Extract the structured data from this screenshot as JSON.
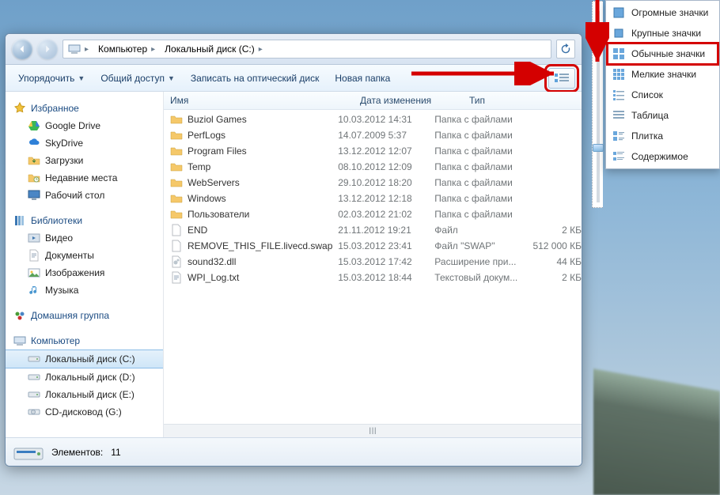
{
  "breadcrumb": {
    "root": "Компьютер",
    "drive": "Локальный диск (C:)"
  },
  "toolbar": {
    "organize": "Упорядочить",
    "share": "Общий доступ",
    "burn": "Записать на оптический диск",
    "newfolder": "Новая папка"
  },
  "columns": {
    "name": "Имя",
    "date": "Дата изменения",
    "type": "Тип"
  },
  "sidebar": {
    "favorites": {
      "label": "Избранное",
      "items": [
        "Google Drive",
        "SkyDrive",
        "Загрузки",
        "Недавние места",
        "Рабочий стол"
      ]
    },
    "libraries": {
      "label": "Библиотеки",
      "items": [
        "Видео",
        "Документы",
        "Изображения",
        "Музыка"
      ]
    },
    "homegroup": {
      "label": "Домашняя группа"
    },
    "computer": {
      "label": "Компьютер",
      "items": [
        "Локальный диск (C:)",
        "Локальный диск (D:)",
        "Локальный диск (E:)",
        "CD-дисковод (G:)"
      ]
    }
  },
  "files": [
    {
      "icon": "folder",
      "name": "Buziol Games",
      "date": "10.03.2012 14:31",
      "type": "Папка с файлами",
      "size": ""
    },
    {
      "icon": "folder",
      "name": "PerfLogs",
      "date": "14.07.2009 5:37",
      "type": "Папка с файлами",
      "size": ""
    },
    {
      "icon": "folder",
      "name": "Program Files",
      "date": "13.12.2012 12:07",
      "type": "Папка с файлами",
      "size": ""
    },
    {
      "icon": "folder",
      "name": "Temp",
      "date": "08.10.2012 12:09",
      "type": "Папка с файлами",
      "size": ""
    },
    {
      "icon": "folder",
      "name": "WebServers",
      "date": "29.10.2012 18:20",
      "type": "Папка с файлами",
      "size": ""
    },
    {
      "icon": "folder",
      "name": "Windows",
      "date": "13.12.2012 12:18",
      "type": "Папка с файлами",
      "size": ""
    },
    {
      "icon": "folder",
      "name": "Пользователи",
      "date": "02.03.2012 21:02",
      "type": "Папка с файлами",
      "size": ""
    },
    {
      "icon": "file",
      "name": "END",
      "date": "21.11.2012 19:21",
      "type": "Файл",
      "size": "2 КБ"
    },
    {
      "icon": "file",
      "name": "REMOVE_THIS_FILE.livecd.swap",
      "date": "15.03.2012 23:41",
      "type": "Файл \"SWAP\"",
      "size": "512 000 КБ"
    },
    {
      "icon": "dll",
      "name": "sound32.dll",
      "date": "15.03.2012 17:42",
      "type": "Расширение при...",
      "size": "44 КБ"
    },
    {
      "icon": "txt",
      "name": "WPI_Log.txt",
      "date": "15.03.2012 18:44",
      "type": "Текстовый докум...",
      "size": "2 КБ"
    }
  ],
  "status": {
    "count_label": "Элементов:",
    "count": "11"
  },
  "viewmenu": {
    "extra_large": "Огромные значки",
    "large": "Крупные значки",
    "medium": "Обычные значки",
    "small": "Мелкие значки",
    "list": "Список",
    "details": "Таблица",
    "tiles": "Плитка",
    "content": "Содержимое"
  },
  "scrollbar_marker": "III"
}
